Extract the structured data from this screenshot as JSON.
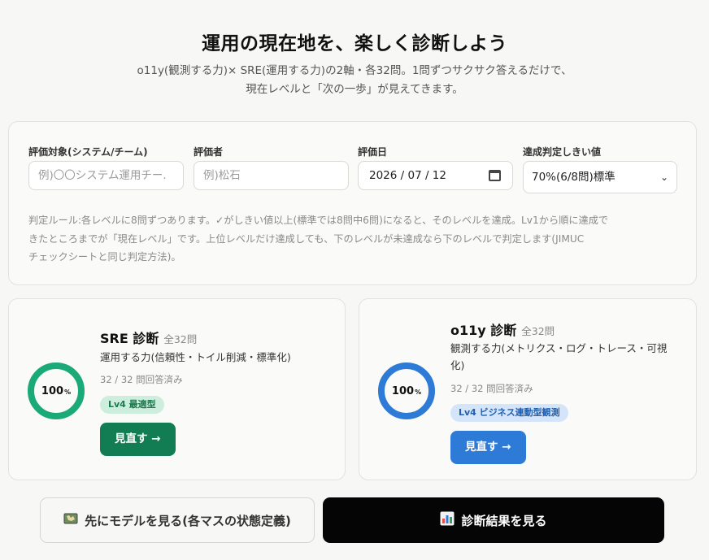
{
  "header": {
    "title": "運用の現在地を、楽しく診断しよう",
    "subtitle_line1": "o11y(観測する力)× SRE(運用する力)の2軸・各32問。1問ずつサクサク答えるだけで、",
    "subtitle_line2": "現在レベルと「次の一歩」が見えてきます。"
  },
  "form": {
    "target": {
      "label": "評価対象(システム/チーム)",
      "placeholder": "例)〇〇システム運用チー."
    },
    "evaluator": {
      "label": "評価者",
      "placeholder": "例)松石"
    },
    "date": {
      "label": "評価日",
      "value": "2026 / 07 / 12",
      "icon": "calendar-icon"
    },
    "threshold": {
      "label": "達成判定しきい値",
      "selected": "70%(6/8問)標準",
      "icon": "chevron-down-icon"
    },
    "rule_line1": "判定ルール:各レベルに8問ずつあります。✓がしきい値以上(標準では8問中6問)になると、そのレベルを達成。Lv1から順に達成で",
    "rule_line2": "きたところまでが「現在レベル」です。上位レベルだけ達成しても、下のレベルが未達成なら下のレベルで判定します(JIMUC",
    "rule_line3": "チェックシートと同じ判定方法)。"
  },
  "sre": {
    "percent": "100",
    "percent_unit": "%",
    "progress_fraction": 1.0,
    "title": "SRE 診断",
    "count": "全32問",
    "description": "運用する力(信頼性・トイル削減・標準化)",
    "answered": "32 / 32 問回答済み",
    "badge": "Lv4 最適型",
    "button": "見直す →",
    "color": "#1aaa7a",
    "button_color": "#127c52",
    "badge_bg": "#cdeedd",
    "badge_fg": "#1b7a4e"
  },
  "o11y": {
    "percent": "100",
    "percent_unit": "%",
    "progress_fraction": 1.0,
    "title": "o11y 診断",
    "count": "全32問",
    "description_line1": "観測する力(メトリクス・ログ・トレース・可視",
    "description_line2": "化)",
    "answered": "32 / 32 問回答済み",
    "badge": "Lv4 ビジネス連動型観測",
    "button": "見直す →",
    "color": "#2d7bd6",
    "button_color": "#2d7bd6",
    "badge_bg": "#d4e5fa",
    "badge_fg": "#1f5fae"
  },
  "actions": {
    "model_button": "先にモデルを見る(各マスの状態定義)",
    "model_icon": "map-icon",
    "result_button": "診断結果を見る",
    "result_icon": "bar-chart-icon"
  }
}
